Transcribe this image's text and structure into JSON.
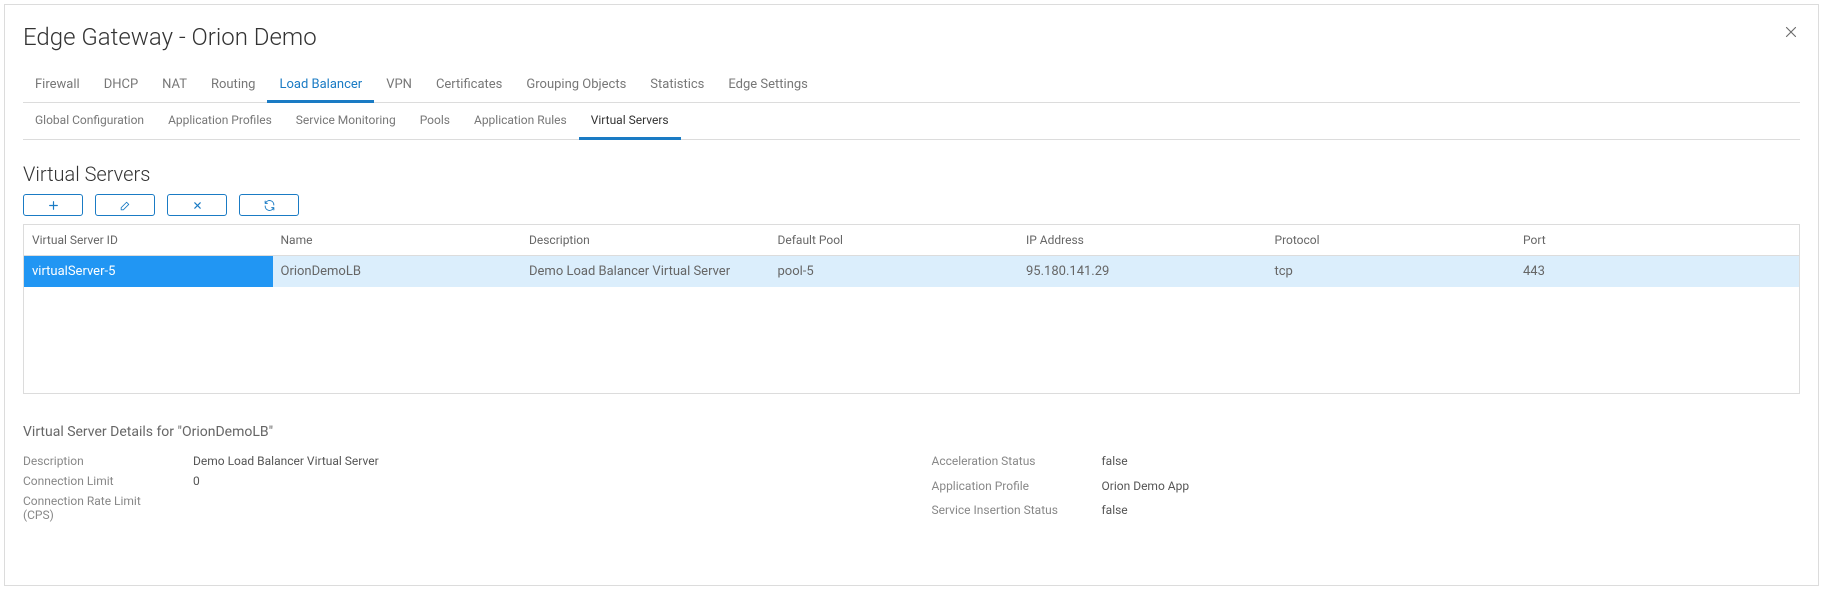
{
  "header": {
    "title": "Edge Gateway - Orion Demo"
  },
  "tabs": [
    {
      "label": "Firewall",
      "active": false
    },
    {
      "label": "DHCP",
      "active": false
    },
    {
      "label": "NAT",
      "active": false
    },
    {
      "label": "Routing",
      "active": false
    },
    {
      "label": "Load Balancer",
      "active": true
    },
    {
      "label": "VPN",
      "active": false
    },
    {
      "label": "Certificates",
      "active": false
    },
    {
      "label": "Grouping Objects",
      "active": false
    },
    {
      "label": "Statistics",
      "active": false
    },
    {
      "label": "Edge Settings",
      "active": false
    }
  ],
  "sub_tabs": [
    {
      "label": "Global Configuration",
      "active": false
    },
    {
      "label": "Application Profiles",
      "active": false
    },
    {
      "label": "Service Monitoring",
      "active": false
    },
    {
      "label": "Pools",
      "active": false
    },
    {
      "label": "Application Rules",
      "active": false
    },
    {
      "label": "Virtual Servers",
      "active": true
    }
  ],
  "section": {
    "title": "Virtual Servers"
  },
  "table": {
    "headers": {
      "id": "Virtual Server ID",
      "name": "Name",
      "description": "Description",
      "default_pool": "Default Pool",
      "ip_address": "IP Address",
      "protocol": "Protocol",
      "port": "Port"
    },
    "rows": [
      {
        "id": "virtualServer-5",
        "name": "OrionDemoLB",
        "description": "Demo Load Balancer Virtual Server",
        "default_pool": "pool-5",
        "ip_address": "95.180.141.29",
        "protocol": "tcp",
        "port": "443",
        "selected": true
      }
    ]
  },
  "details": {
    "title": "Virtual Server Details for \"OrionDemoLB\"",
    "left": {
      "description_label": "Description",
      "description_value": "Demo Load Balancer Virtual Server",
      "connection_limit_label": "Connection Limit",
      "connection_limit_value": "0",
      "connection_rate_limit_label": "Connection Rate Limit (CPS)",
      "connection_rate_limit_value": ""
    },
    "right": {
      "acceleration_status_label": "Acceleration Status",
      "acceleration_status_value": "false",
      "application_profile_label": "Application Profile",
      "application_profile_value": "Orion Demo App",
      "service_insertion_status_label": "Service Insertion Status",
      "service_insertion_status_value": "false"
    }
  }
}
